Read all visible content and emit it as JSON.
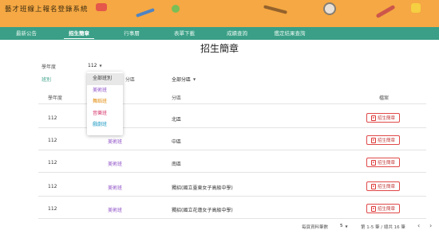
{
  "app": {
    "title": "藝才班線上報名登錄系統"
  },
  "nav": {
    "items": [
      {
        "label": "最新公告"
      },
      {
        "label": "招生簡章"
      },
      {
        "label": "行事曆"
      },
      {
        "label": "表單下載"
      },
      {
        "label": "成績查詢"
      },
      {
        "label": "鑑定結果查詢"
      }
    ],
    "active_index": 1
  },
  "page": {
    "title": "招生簡章"
  },
  "filters": {
    "year_label": "學年度",
    "year_value": "112",
    "class_label": "班別",
    "area_label": "分區",
    "area_value": "全部分區"
  },
  "class_dropdown": {
    "options": [
      {
        "label": "全部班別",
        "color": "#333333",
        "selected": true
      },
      {
        "label": "美術班",
        "color": "#8e4fc6",
        "selected": false
      },
      {
        "label": "舞蹈班",
        "color": "#e28a0b",
        "selected": false
      },
      {
        "label": "音樂班",
        "color": "#d6336c",
        "selected": false
      },
      {
        "label": "戲劇班",
        "color": "#1f9bc4",
        "selected": false
      }
    ]
  },
  "table": {
    "headers": {
      "year": "學年度",
      "class": "班別",
      "area": "分區",
      "file": "檔案"
    },
    "rows": [
      {
        "year": "112",
        "class": "美術班",
        "area": "北區",
        "file": "招生簡章"
      },
      {
        "year": "112",
        "class": "美術班",
        "area": "中區",
        "file": "招生簡章"
      },
      {
        "year": "112",
        "class": "美術班",
        "area": "南區",
        "file": "招生簡章"
      },
      {
        "year": "112",
        "class": "美術班",
        "area": "獨招(國立臺東女子高級中學)",
        "file": "招生簡章"
      },
      {
        "year": "112",
        "class": "美術班",
        "area": "獨招(國立花蓮女子高級中學)",
        "file": "招生簡章"
      }
    ]
  },
  "pagination": {
    "rows_label": "每頁資料筆數",
    "rows_value": "5",
    "range_text": "第 1-5 筆 / 總共 16 筆",
    "prev_icon": "‹",
    "next_icon": "›"
  }
}
